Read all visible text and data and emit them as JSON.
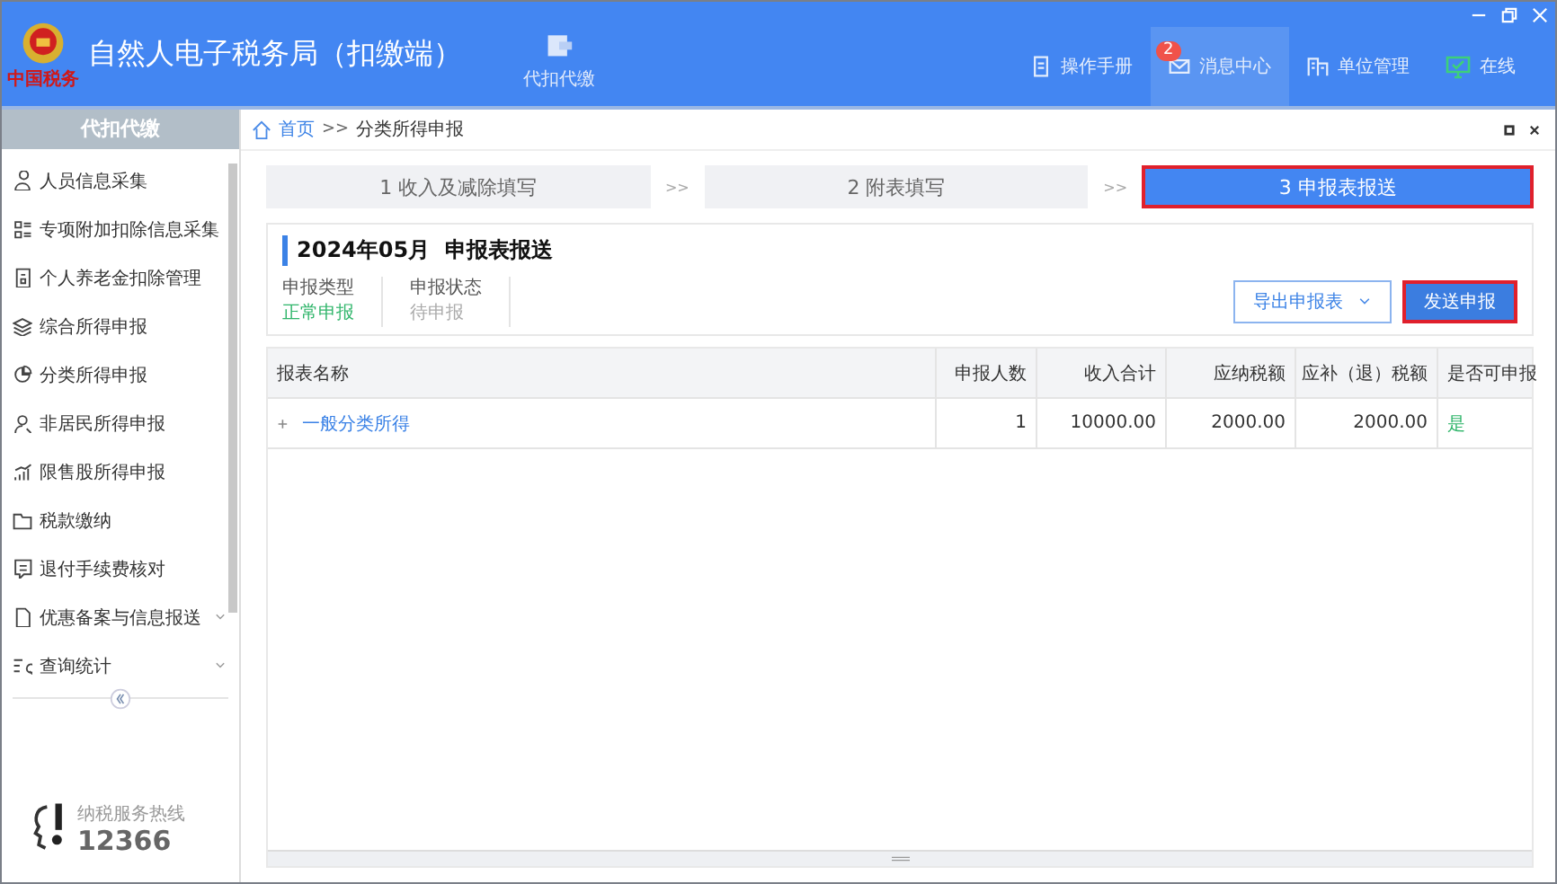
{
  "app": {
    "title": "自然人电子税务局（扣缴端）",
    "logo_caption": "中国税务",
    "module": "代扣代缴"
  },
  "nav": [
    {
      "label": "操作手册",
      "selected": false
    },
    {
      "label": "消息中心",
      "selected": true,
      "badge": "2"
    },
    {
      "label": "单位管理",
      "selected": false
    },
    {
      "label": "在线",
      "selected": false
    }
  ],
  "sidebar": {
    "title": "代扣代缴",
    "items": [
      {
        "label": "人员信息采集",
        "expandable": false
      },
      {
        "label": "专项附加扣除信息采集",
        "expandable": false
      },
      {
        "label": "个人养老金扣除管理",
        "expandable": false
      },
      {
        "label": "综合所得申报",
        "expandable": false
      },
      {
        "label": "分类所得申报",
        "expandable": false
      },
      {
        "label": "非居民所得申报",
        "expandable": false
      },
      {
        "label": "限售股所得申报",
        "expandable": false
      },
      {
        "label": "税款缴纳",
        "expandable": false
      },
      {
        "label": "退付手续费核对",
        "expandable": false
      },
      {
        "label": "优惠备案与信息报送",
        "expandable": true
      },
      {
        "label": "查询统计",
        "expandable": true
      }
    ],
    "hotline_label": "纳税服务热线",
    "hotline": "12366"
  },
  "breadcrumb": [
    "首页",
    "分类所得申报"
  ],
  "breadcrumb_separator": ">>",
  "steps": [
    {
      "label": "1 收入及减除填写",
      "selected": false,
      "outlined": false
    },
    {
      "label": "2 附表填写",
      "selected": false,
      "outlined": false
    },
    {
      "label": "3 申报表报送",
      "selected": true,
      "outlined": true
    }
  ],
  "step_separator": ">>",
  "report": {
    "title": "2024年05月  申报表报送",
    "fields": [
      {
        "label": "申报类型",
        "value": "正常申报",
        "kind": "ok"
      },
      {
        "label": "申报状态",
        "value": "待申报",
        "kind": "muted"
      }
    ],
    "buttons": [
      {
        "label": "导出申报表",
        "kind": "dropdown",
        "outlined": false
      },
      {
        "label": "发送申报",
        "kind": "primary",
        "outlined": true
      }
    ]
  },
  "table": {
    "columns": [
      "报表名称",
      "申报人数",
      "收入合计",
      "应纳税额",
      "应补（退）税额",
      "是否可申报"
    ],
    "rows": [
      {
        "cells": [
          "一般分类所得",
          "1",
          "10000.00",
          "2000.00",
          "2000.00",
          "是"
        ]
      }
    ]
  }
}
